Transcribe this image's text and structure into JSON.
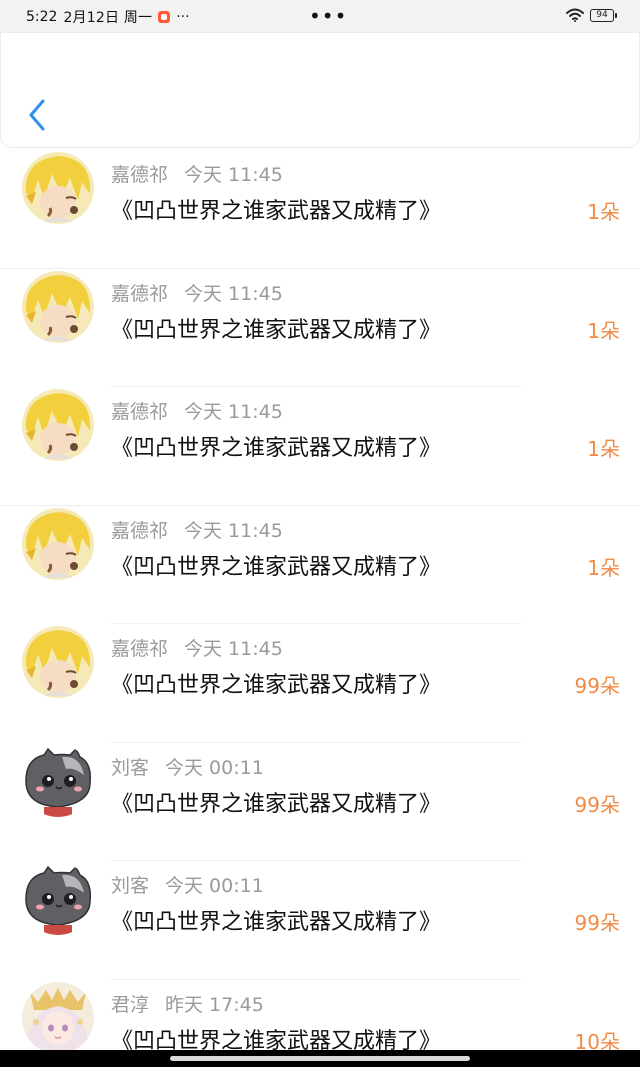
{
  "status_bar": {
    "time": "5:22",
    "date": "2月12日 周一",
    "more": "···",
    "center_dots": "•••",
    "battery": "94"
  },
  "header": {
    "back_icon": "chevron-left-icon"
  },
  "colors": {
    "accent_blue": "#2f8ff0",
    "amount_orange": "#f08a44",
    "meta_gray": "#9a9a9a"
  },
  "items": [
    {
      "user": "嘉德祁",
      "time": "今天 11:45",
      "title": "《凹凸世界之谁家武器又成精了》",
      "amount": "1朵",
      "avatar": "blonde-character-avatar"
    },
    {
      "user": "嘉德祁",
      "time": "今天 11:45",
      "title": "《凹凸世界之谁家武器又成精了》",
      "amount": "1朵",
      "avatar": "blonde-character-avatar"
    },
    {
      "user": "嘉德祁",
      "time": "今天 11:45",
      "title": "《凹凸世界之谁家武器又成精了》",
      "amount": "1朵",
      "avatar": "blonde-character-avatar"
    },
    {
      "user": "嘉德祁",
      "time": "今天 11:45",
      "title": "《凹凸世界之谁家武器又成精了》",
      "amount": "1朵",
      "avatar": "blonde-character-avatar"
    },
    {
      "user": "嘉德祁",
      "time": "今天 11:45",
      "title": "《凹凸世界之谁家武器又成精了》",
      "amount": "99朵",
      "avatar": "blonde-character-avatar"
    },
    {
      "user": "刘客",
      "time": "今天 00:11",
      "title": "《凹凸世界之谁家武器又成精了》",
      "amount": "99朵",
      "avatar": "gray-cat-avatar"
    },
    {
      "user": "刘客",
      "time": "今天 00:11",
      "title": "《凹凸世界之谁家武器又成精了》",
      "amount": "99朵",
      "avatar": "gray-cat-avatar"
    },
    {
      "user": "君淳",
      "time": "昨天 17:45",
      "title": "《凹凸世界之谁家武器又成精了》",
      "amount": "10朵",
      "avatar": "fairy-girl-avatar"
    }
  ]
}
